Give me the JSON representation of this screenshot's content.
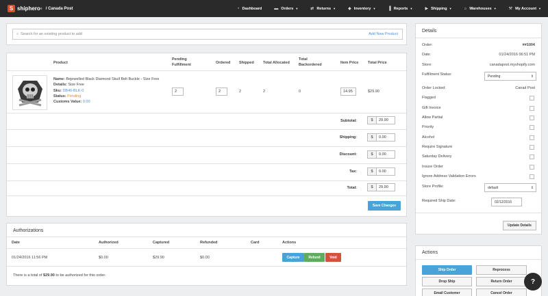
{
  "brand": {
    "logo_letter": "S",
    "name": "shiphero",
    "trademark": "®",
    "breadcrumb": "/ Canada Post"
  },
  "nav": [
    {
      "icon": "speedometer-icon",
      "glyph": "◔",
      "label": "Dashboard",
      "caret": false
    },
    {
      "icon": "folder-icon",
      "glyph": "▬",
      "label": "Orders",
      "caret": true
    },
    {
      "icon": "returns-icon",
      "glyph": "⇄",
      "label": "Returns",
      "caret": true
    },
    {
      "icon": "tag-icon",
      "glyph": "◆",
      "label": "Inventory",
      "caret": true
    },
    {
      "icon": "bar-chart-icon",
      "glyph": "▐",
      "label": "Reports",
      "caret": true
    },
    {
      "icon": "truck-icon",
      "glyph": "▶",
      "label": "Shipping",
      "caret": true
    },
    {
      "icon": "warehouse-icon",
      "glyph": "⌂",
      "label": "Warehouses",
      "caret": true
    },
    {
      "icon": "wrench-icon",
      "glyph": "⚒",
      "label": "My Account",
      "caret": true
    }
  ],
  "search": {
    "placeholder": "Search for an existing product to add",
    "add_link": "Add New Product"
  },
  "table": {
    "headers": {
      "product": "Product",
      "pending": [
        "Pending",
        "Fulfillment"
      ],
      "ordered": "Ordered",
      "shipped": "Shipped",
      "allocated": "Total Allocated",
      "backordered": [
        "Total",
        "Backordered"
      ],
      "item_price": "Item Price",
      "total_price": "Total Price"
    },
    "row": {
      "name_label": "Name:",
      "name": "Bejewelled Black Diamond Skull Belt Buckle - Size Free",
      "details_label": "Details:",
      "details": "Size Free",
      "sku_label": "Sku:",
      "sku": "DB46-BLK-0",
      "status_label": "Status:",
      "status": "Pending",
      "customs_label": "Customs Value:",
      "customs": "0.00",
      "pending": "2",
      "ordered": "2",
      "shipped": "2",
      "allocated": "2",
      "backordered": "0",
      "item_price": "14.95",
      "total_price": "$29.90"
    }
  },
  "totals": {
    "currency": "$",
    "rows": [
      {
        "label": "Subtotal:",
        "value": "29.90"
      },
      {
        "label": "Shipping:",
        "value": "0.00"
      },
      {
        "label": "Discount:",
        "value": "0.00"
      },
      {
        "label": "Tax:",
        "value": "0.00"
      },
      {
        "label": "Total:",
        "value": "29.90"
      }
    ],
    "save_button": "Save Changes"
  },
  "authorizations": {
    "title": "Authorizations",
    "headers": [
      "Date",
      "Authorized",
      "Captured",
      "Refunded",
      "Card",
      "Actions"
    ],
    "row": {
      "date": "01/24/2016 11:56 PM",
      "authorized": "$0.00",
      "captured": "$29.90",
      "refunded": "$0.00",
      "card": ""
    },
    "buttons": {
      "capture": "Capture",
      "refund": "Refund",
      "void": "Void"
    },
    "note_prefix": "There is a total of ",
    "note_amount": "$29.90",
    "note_suffix": " to be authorized for this order."
  },
  "details": {
    "title": "Details",
    "order_label": "Order:",
    "order": "##1004",
    "date_label": "Date:",
    "date": "01/24/2016 06:51 PM",
    "store_label": "Store:",
    "store": "canadapost.myshopify.com",
    "fulfillment_label": "Fulfillment Status:",
    "fulfillment": "Pending",
    "locked_label": "Order Locked:",
    "locked": "Canad Post",
    "checkboxes": [
      "Flagged",
      "Gift Invoice",
      "Allow Partial",
      "Priority",
      "Alcohol",
      "Require Signature",
      "Saturday Delivery",
      "Insure Order",
      "Ignore Address Validation Errors"
    ],
    "profile_label": "Store Profile:",
    "profile": "default",
    "ship_date_label": "Required Ship Date:",
    "ship_date": "02/12/2016",
    "update_button": "Update Details"
  },
  "actions": {
    "title": "Actions",
    "ship_order": "Ship Order",
    "reprocess": "Reprocess",
    "drop_ship": "Drop Ship",
    "return_order": "Return Order",
    "email_customer": "Email Customer",
    "cancel_order": "Cancel Order"
  },
  "chat": {
    "glyph": "?"
  },
  "colors": {
    "accent": "#4aa3d8",
    "topbar": "#2a2a2a",
    "brand": "#e34b26",
    "link": "#4a90d9",
    "pending": "#e08a1e",
    "refund": "#5cae5c",
    "void": "#d2533c"
  }
}
